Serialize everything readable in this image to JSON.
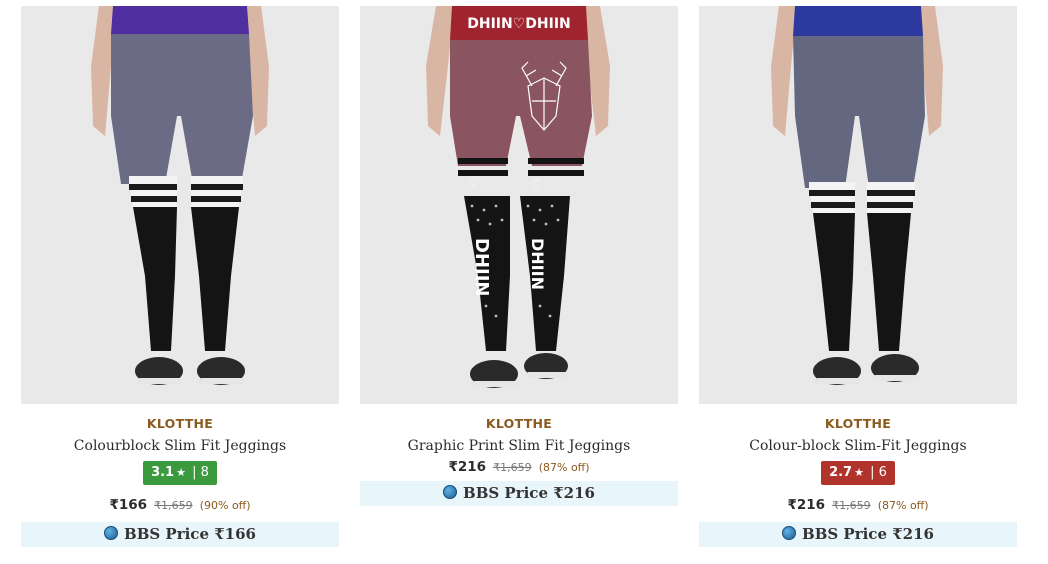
{
  "products": [
    {
      "brand": "KLOTTHE",
      "title": "Colourblock Slim Fit Jeggings",
      "rating": {
        "score": "3.1",
        "star": "★",
        "count": "8",
        "color": "#3c9a3e"
      },
      "price": "₹166",
      "mrp": "₹1,659",
      "discount": "(90% off)",
      "bbs_label": "BBS Price ₹166",
      "image": {
        "waistband": "#4f2ea0",
        "upper": "#6b6b86",
        "stripes": "white",
        "lower": "#141414"
      }
    },
    {
      "brand": "KLOTTHE",
      "title": "Graphic Print Slim Fit Jeggings",
      "price": "₹216",
      "mrp": "₹1,659",
      "discount": "(87% off)",
      "bbs_label": "BBS Price ₹216",
      "image": {
        "waistband": "#a02430",
        "waistband_text": "DHIIN♡DHIIN",
        "upper": "#8a5560",
        "lower": "#141414",
        "leg_text": "DHIIN"
      }
    },
    {
      "brand": "KLOTTHE",
      "title": "Colour-block Slim-Fit Jeggings",
      "rating": {
        "score": "2.7",
        "star": "★",
        "count": "6",
        "color": "#b0332c"
      },
      "price": "₹216",
      "mrp": "₹1,659",
      "discount": "(87% off)",
      "bbs_label": "BBS Price ₹216",
      "image": {
        "waistband": "#2c3aa0",
        "upper": "#636880",
        "stripes": "white",
        "lower": "#141414"
      }
    }
  ]
}
